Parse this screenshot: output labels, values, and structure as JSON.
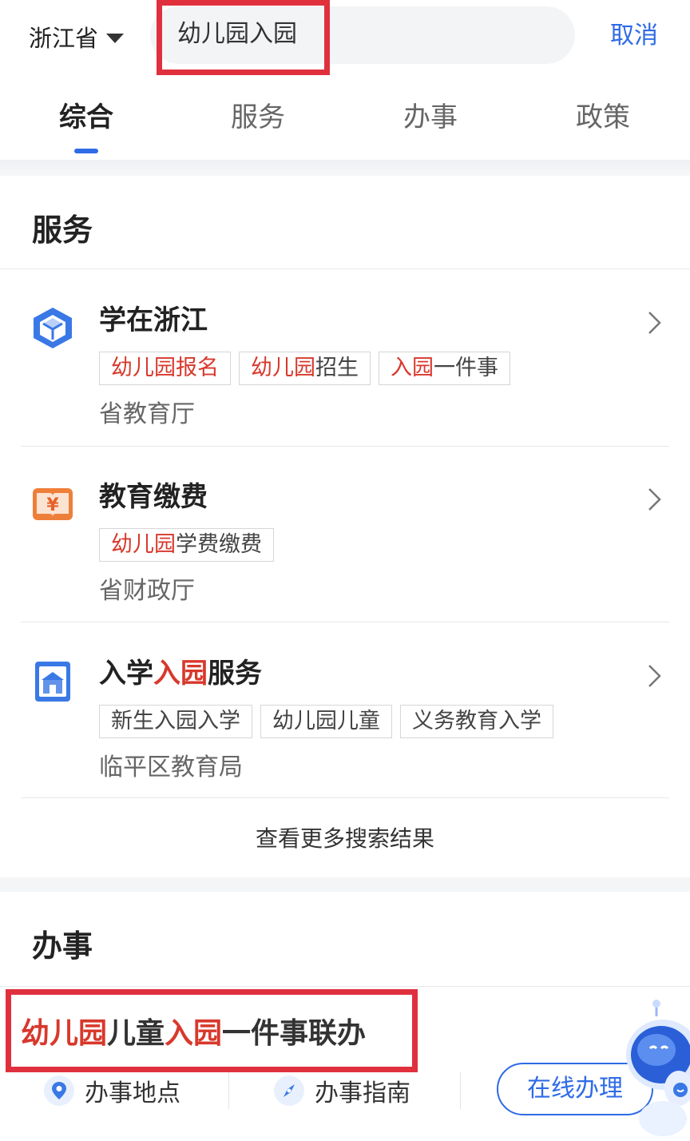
{
  "header": {
    "region": "浙江省",
    "search_value": "幼儿园入园",
    "cancel": "取消"
  },
  "tabs": [
    {
      "label": "综合",
      "active": true
    },
    {
      "label": "服务",
      "active": false
    },
    {
      "label": "办事",
      "active": false
    },
    {
      "label": "政策",
      "active": false
    }
  ],
  "services": {
    "title": "服务",
    "items": [
      {
        "title": "学在浙江",
        "icon": "cube-icon",
        "tags": [
          {
            "hl": "幼儿园报名",
            "rest": ""
          },
          {
            "hl": "幼儿园",
            "rest": "招生"
          },
          {
            "hl": "入园",
            "rest": "一件事"
          }
        ],
        "dept": "省教育厅"
      },
      {
        "title": "教育缴费",
        "icon": "yuan-book-icon",
        "tags": [
          {
            "hl": "幼儿园",
            "rest": "学费缴费"
          }
        ],
        "dept": "省财政厅"
      },
      {
        "title_pre": "入学",
        "title_hl": "入园",
        "title_post": "服务",
        "icon": "school-building-icon",
        "tags": [
          {
            "hl": "",
            "rest": "新生入园入学"
          },
          {
            "hl": "",
            "rest": "幼儿园儿童"
          },
          {
            "hl": "",
            "rest": "义务教育入学"
          }
        ],
        "dept": "临平区教育局"
      }
    ],
    "more": "查看更多搜索结果"
  },
  "affairs": {
    "title": "办事",
    "item": {
      "seg1": "幼儿园",
      "seg2": "儿童",
      "seg3": "入园",
      "seg4": "一件事联办"
    },
    "actions": {
      "location": "办事地点",
      "guide": "办事指南",
      "online": "在线办理"
    }
  },
  "colors": {
    "accent": "#2e6be6",
    "highlight_text": "#d8382c",
    "annotation_box": "#e0303e"
  }
}
